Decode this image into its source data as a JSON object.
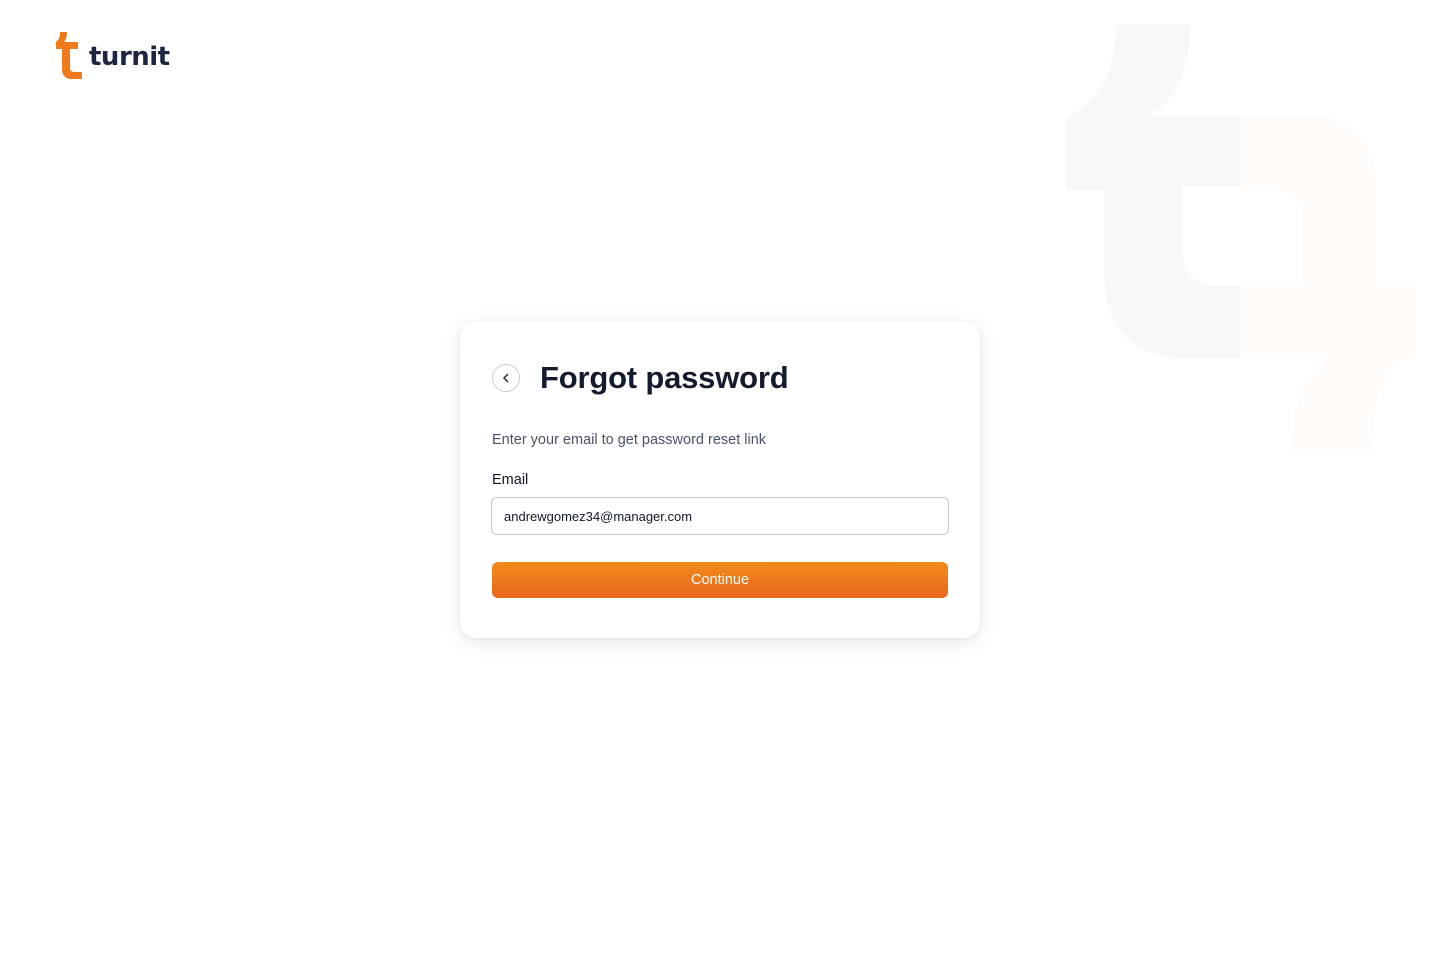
{
  "brand": {
    "name": "turnit",
    "logo_icon": "turnit-t-logo-icon",
    "accent_color": "#ee7a1c",
    "text_color": "#1d2540"
  },
  "background": {
    "watermark_icon": "turnit-watermark-icon"
  },
  "card": {
    "title": "Forgot password",
    "back_icon": "chevron-left-icon",
    "subtitle": "Enter your email to get password reset link",
    "email": {
      "label": "Email",
      "value": "andrewgomez34@manager.com",
      "placeholder": ""
    },
    "continue_label": "Continue"
  }
}
